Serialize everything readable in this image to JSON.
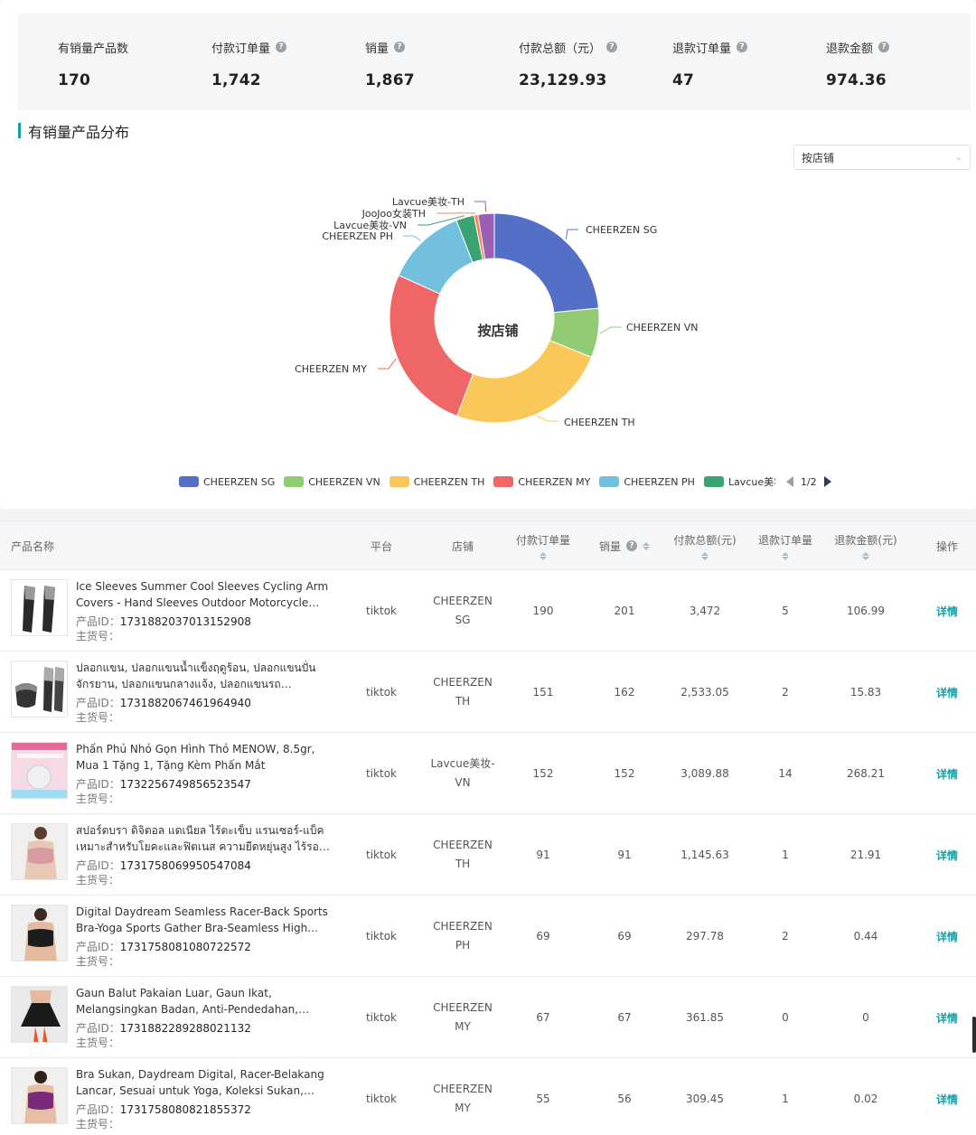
{
  "stats": [
    {
      "label": "有销量产品数",
      "value": "170",
      "help": false
    },
    {
      "label": "付款订单量",
      "value": "1,742",
      "help": true
    },
    {
      "label": "销量",
      "value": "1,867",
      "help": true
    },
    {
      "label": "付款总额（元）",
      "value": "23,129.93",
      "help": true
    },
    {
      "label": "退款订单量",
      "value": "47",
      "help": true
    },
    {
      "label": "退款金额",
      "value": "974.36",
      "help": true
    }
  ],
  "section": {
    "title": "有销量产品分布"
  },
  "group_select": {
    "value": "按店铺"
  },
  "chart_data": {
    "type": "pie",
    "center_label": "按店铺",
    "slices": [
      {
        "label": "CHEERZEN SG",
        "value": 23.5,
        "color": "#5470c6"
      },
      {
        "label": "CHEERZEN VN",
        "value": 7.6,
        "color": "#91cc75"
      },
      {
        "label": "CHEERZEN TH",
        "value": 24.7,
        "color": "#fac858"
      },
      {
        "label": "CHEERZEN MY",
        "value": 25.9,
        "color": "#ee6666"
      },
      {
        "label": "CHEERZEN PH",
        "value": 12.4,
        "color": "#73c0de"
      },
      {
        "label": "Lavcue美妆-VN",
        "value": 2.8,
        "color": "#3ba272"
      },
      {
        "label": "JooJoo女装TH",
        "value": 0.6,
        "color": "#fc8452"
      },
      {
        "label": "Lavcue美妆-TH",
        "value": 2.5,
        "color": "#9a60b4"
      }
    ],
    "legend": {
      "items": [
        "CHEERZEN SG",
        "CHEERZEN VN",
        "CHEERZEN TH",
        "CHEERZEN MY",
        "CHEERZEN PH",
        "Lavcue美妆-VN"
      ],
      "page": "1/2"
    }
  },
  "table": {
    "headers": {
      "product": "产品名称",
      "platform": "平台",
      "shop": "店铺",
      "orders": "付款订单量",
      "sales": "销量",
      "amount": "付款总额(元)",
      "refund_orders": "退款订单量",
      "refund_amount": "退款金额(元)",
      "action": "操作"
    },
    "id_label": "产品ID：",
    "sku_label": "主货号：",
    "detail_label": "详情",
    "rows": [
      {
        "name": "Ice Sleeves Summer Cool Sleeves Cycling Arm Covers - Hand Sleeves Outdoor Motorcycle Fishing Sun Protection",
        "id": "1731882037013152908",
        "platform": "tiktok",
        "shop_l1": "CHEERZEN",
        "shop_l2": "SG",
        "orders": "190",
        "sales": "201",
        "amount": "3,472",
        "refund_orders": "5",
        "refund_amount": "106.99",
        "thumb": "sleeves"
      },
      {
        "name": "ปลอกแขน, ปลอกแขนน้ำแข็งฤดูร้อน, ปลอกแขนปั่นจักรยาน, ปลอกแขนกลางแจ้ง, ปลอกแขนรถจักรยานยนต์, ตกปลา",
        "id": "1731882067461964940",
        "platform": "tiktok",
        "shop_l1": "CHEERZEN",
        "shop_l2": "TH",
        "orders": "151",
        "sales": "162",
        "amount": "2,533.05",
        "refund_orders": "2",
        "refund_amount": "15.83",
        "thumb": "sleeves-mask"
      },
      {
        "name": "Phấn Phủ Nhỏ Gọn Hình Thỏ MENOW, 8.5gr, Mua 1 Tặng 1, Tặng Kèm Phấn Mắt",
        "id": "1732256749856523547",
        "platform": "tiktok",
        "shop_l1": "Lavcue美妆-",
        "shop_l2": "VN",
        "orders": "152",
        "sales": "152",
        "amount": "3,089.88",
        "refund_orders": "14",
        "refund_amount": "268.21",
        "thumb": "powder"
      },
      {
        "name": "สปอร์ตบรา ดิจิตอล แดเนียล ไร้ตะเข็บ แรนเซอร์-แบ็ค เหมาะสำหรับโยคะและฟิตเนส ความยืดหยุ่นสูง ไร้รอยต่อ นุ่มสบาย",
        "id": "1731758069950547084",
        "platform": "tiktok",
        "shop_l1": "CHEERZEN",
        "shop_l2": "TH",
        "orders": "91",
        "sales": "91",
        "amount": "1,145.63",
        "refund_orders": "1",
        "refund_amount": "21.91",
        "thumb": "bra-pink"
      },
      {
        "name": "Digital Daydream Seamless Racer-Back Sports Bra-Yoga Sports Gather Bra-Seamless High Elasticity Comfort",
        "id": "1731758081080722572",
        "platform": "tiktok",
        "shop_l1": "CHEERZEN",
        "shop_l2": "PH",
        "orders": "69",
        "sales": "69",
        "amount": "297.78",
        "refund_orders": "2",
        "refund_amount": "0.44",
        "thumb": "bra-black"
      },
      {
        "name": "Gaun Balut Pakaian Luar, Gaun Ikat, Melangsingkan Badan, Anti-Pendedahan, Sesuai untuk Yoga, Sukan",
        "id": "1731882289288021132",
        "platform": "tiktok",
        "shop_l1": "CHEERZEN",
        "shop_l2": "MY",
        "orders": "67",
        "sales": "67",
        "amount": "361.85",
        "refund_orders": "0",
        "refund_amount": "0",
        "thumb": "skirt"
      },
      {
        "name": "Bra Sukan, Daydream Digital, Racer-Belakang Lancar, Sesuai untuk Yoga, Koleksi Sukan, Keanjalan Tinggi",
        "id": "1731758080821855372",
        "platform": "tiktok",
        "shop_l1": "CHEERZEN",
        "shop_l2": "MY",
        "orders": "55",
        "sales": "56",
        "amount": "309.45",
        "refund_orders": "1",
        "refund_amount": "0.02",
        "thumb": "bra-purple"
      }
    ]
  }
}
